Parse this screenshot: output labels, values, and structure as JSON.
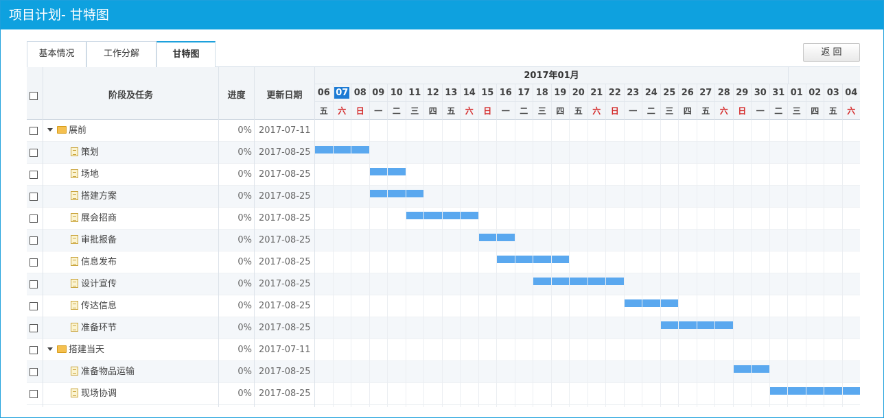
{
  "window": {
    "title": "项目计划- 甘特图"
  },
  "tabs": [
    {
      "label": "基本情况"
    },
    {
      "label": "工作分解"
    },
    {
      "label": "甘特图"
    }
  ],
  "back_button": {
    "label": "返 回"
  },
  "columns": {
    "task": "阶段及任务",
    "progress": "进度",
    "updated": "更新日期"
  },
  "timeline": {
    "month_label": "2017年01月",
    "days": [
      "06",
      "07",
      "08",
      "09",
      "10",
      "11",
      "12",
      "13",
      "14",
      "15",
      "16",
      "17",
      "18",
      "19",
      "20",
      "21",
      "22",
      "23",
      "24",
      "25",
      "26",
      "27",
      "28",
      "29",
      "30",
      "31",
      "01",
      "02",
      "03",
      "04"
    ],
    "weekdays": [
      "五",
      "六",
      "日",
      "一",
      "二",
      "三",
      "四",
      "五",
      "六",
      "日",
      "一",
      "二",
      "三",
      "四",
      "五",
      "六",
      "日",
      "一",
      "二",
      "三",
      "四",
      "五",
      "六",
      "日",
      "一",
      "二",
      "三",
      "四",
      "五",
      "六"
    ],
    "today": "07",
    "colors": {
      "bar": "#5aa8ef",
      "weekend": "#d42a2a",
      "today": "#1d7bd4",
      "titlebar": "#0ea1df"
    }
  },
  "rows": [
    {
      "type": "phase",
      "name": "展前",
      "progress": "0%",
      "updated": "2017-07-11"
    },
    {
      "type": "task",
      "name": "策划",
      "progress": "0%",
      "updated": "2017-08-25",
      "start": "2017-01-06",
      "end": "2017-01-08"
    },
    {
      "type": "task",
      "name": "场地",
      "progress": "0%",
      "updated": "2017-08-25",
      "start": "2017-01-09",
      "end": "2017-01-10"
    },
    {
      "type": "task",
      "name": "搭建方案",
      "progress": "0%",
      "updated": "2017-08-25",
      "start": "2017-01-09",
      "end": "2017-01-11"
    },
    {
      "type": "task",
      "name": "展会招商",
      "progress": "0%",
      "updated": "2017-08-25",
      "start": "2017-01-11",
      "end": "2017-01-14"
    },
    {
      "type": "task",
      "name": "审批报备",
      "progress": "0%",
      "updated": "2017-08-25",
      "start": "2017-01-15",
      "end": "2017-01-16"
    },
    {
      "type": "task",
      "name": "信息发布",
      "progress": "0%",
      "updated": "2017-08-25",
      "start": "2017-01-16",
      "end": "2017-01-19"
    },
    {
      "type": "task",
      "name": "设计宣传",
      "progress": "0%",
      "updated": "2017-08-25",
      "start": "2017-01-18",
      "end": "2017-01-22"
    },
    {
      "type": "task",
      "name": "传达信息",
      "progress": "0%",
      "updated": "2017-08-25",
      "start": "2017-01-23",
      "end": "2017-01-25"
    },
    {
      "type": "task",
      "name": "准备环节",
      "progress": "0%",
      "updated": "2017-08-25",
      "start": "2017-01-25",
      "end": "2017-01-28"
    },
    {
      "type": "phase",
      "name": "搭建当天",
      "progress": "0%",
      "updated": "2017-07-11"
    },
    {
      "type": "task",
      "name": "准备物品运输",
      "progress": "0%",
      "updated": "2017-08-25",
      "start": "2017-01-29",
      "end": "2017-01-30"
    },
    {
      "type": "task",
      "name": "现场协调",
      "progress": "0%",
      "updated": "2017-08-25",
      "start": "2017-01-31",
      "end": "2017-02-04"
    }
  ]
}
